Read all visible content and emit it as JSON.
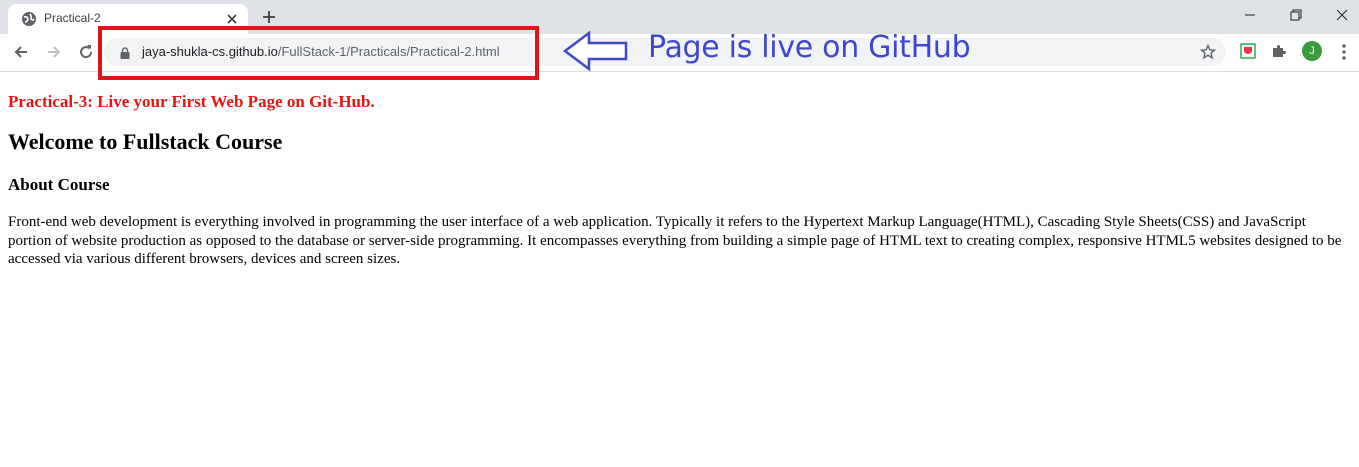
{
  "browser": {
    "tab_title": "Practical-2",
    "url_domain": "jaya-shukla-cs.github.io",
    "url_path": "/FullStack-1/Practicals/Practical-2.html",
    "profile_initial": "J",
    "colors": {
      "tab_strip": "#dee1e6",
      "omnibox": "#f1f3f4",
      "avatar": "#3c9a3c"
    }
  },
  "annotation": {
    "text": "Page is live on GitHub",
    "colors": {
      "box": "#e3111b",
      "arrow": "#3f48cc",
      "text": "#3f48cc"
    }
  },
  "page": {
    "title": "Practical-3: Live your First Web Page on Git-Hub.",
    "heading": "Welcome to Fullstack Course",
    "subheading": "About Course",
    "description": "Front-end web development is everything involved in programming the user interface of a web application. Typically it refers to the Hypertext Markup Language(HTML), Cascading Style Sheets(CSS) and JavaScript portion of website production as opposed to the database or server-side programming. It encompasses everything from building a simple page of HTML text to creating complex, responsive HTML5 websites designed to be accessed via various different browsers, devices and screen sizes.",
    "colors": {
      "title": "#ee1111"
    }
  }
}
